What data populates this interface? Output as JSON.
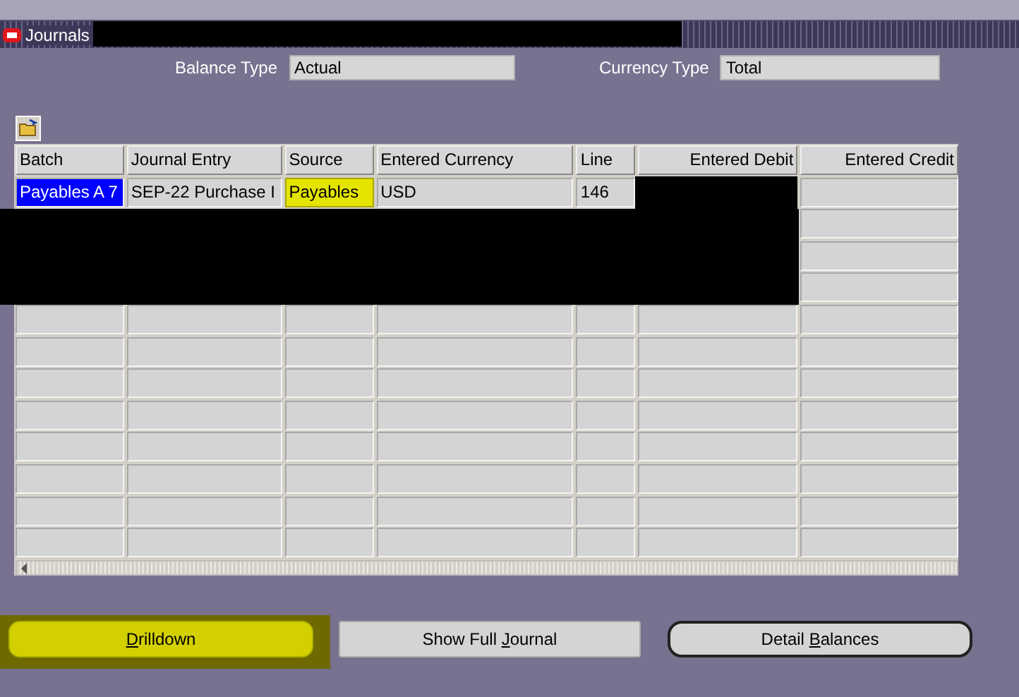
{
  "window": {
    "title": "Journals"
  },
  "fields": [
    {
      "label": "Balance Type",
      "value": "Actual"
    },
    {
      "label": "Currency Type",
      "value": "Total"
    }
  ],
  "table": {
    "columns": [
      "Batch",
      "Journal Entry",
      "Source",
      "Entered Currency",
      "Line",
      "Entered Debit",
      "Entered Credit"
    ],
    "rows": [
      {
        "cells": [
          {
            "text": "Payables A 7",
            "selected": true,
            "highlighted": false
          },
          {
            "text": "SEP-22 Purchase I",
            "selected": false,
            "highlighted": false
          },
          {
            "text": "Payables",
            "selected": false,
            "highlighted": true
          },
          {
            "text": "USD",
            "selected": false,
            "highlighted": false
          },
          {
            "text": "146",
            "selected": false,
            "highlighted": false
          }
        ]
      }
    ]
  },
  "buttons": [
    {
      "key": "D",
      "after": "rilldown",
      "highlighted": true,
      "default": false
    },
    {
      "before": "Show Full ",
      "key": "J",
      "after": "ournal",
      "highlighted": false,
      "default": false
    },
    {
      "before": "Detail ",
      "key": "B",
      "after": "alances",
      "highlighted": false,
      "default": true
    }
  ]
}
